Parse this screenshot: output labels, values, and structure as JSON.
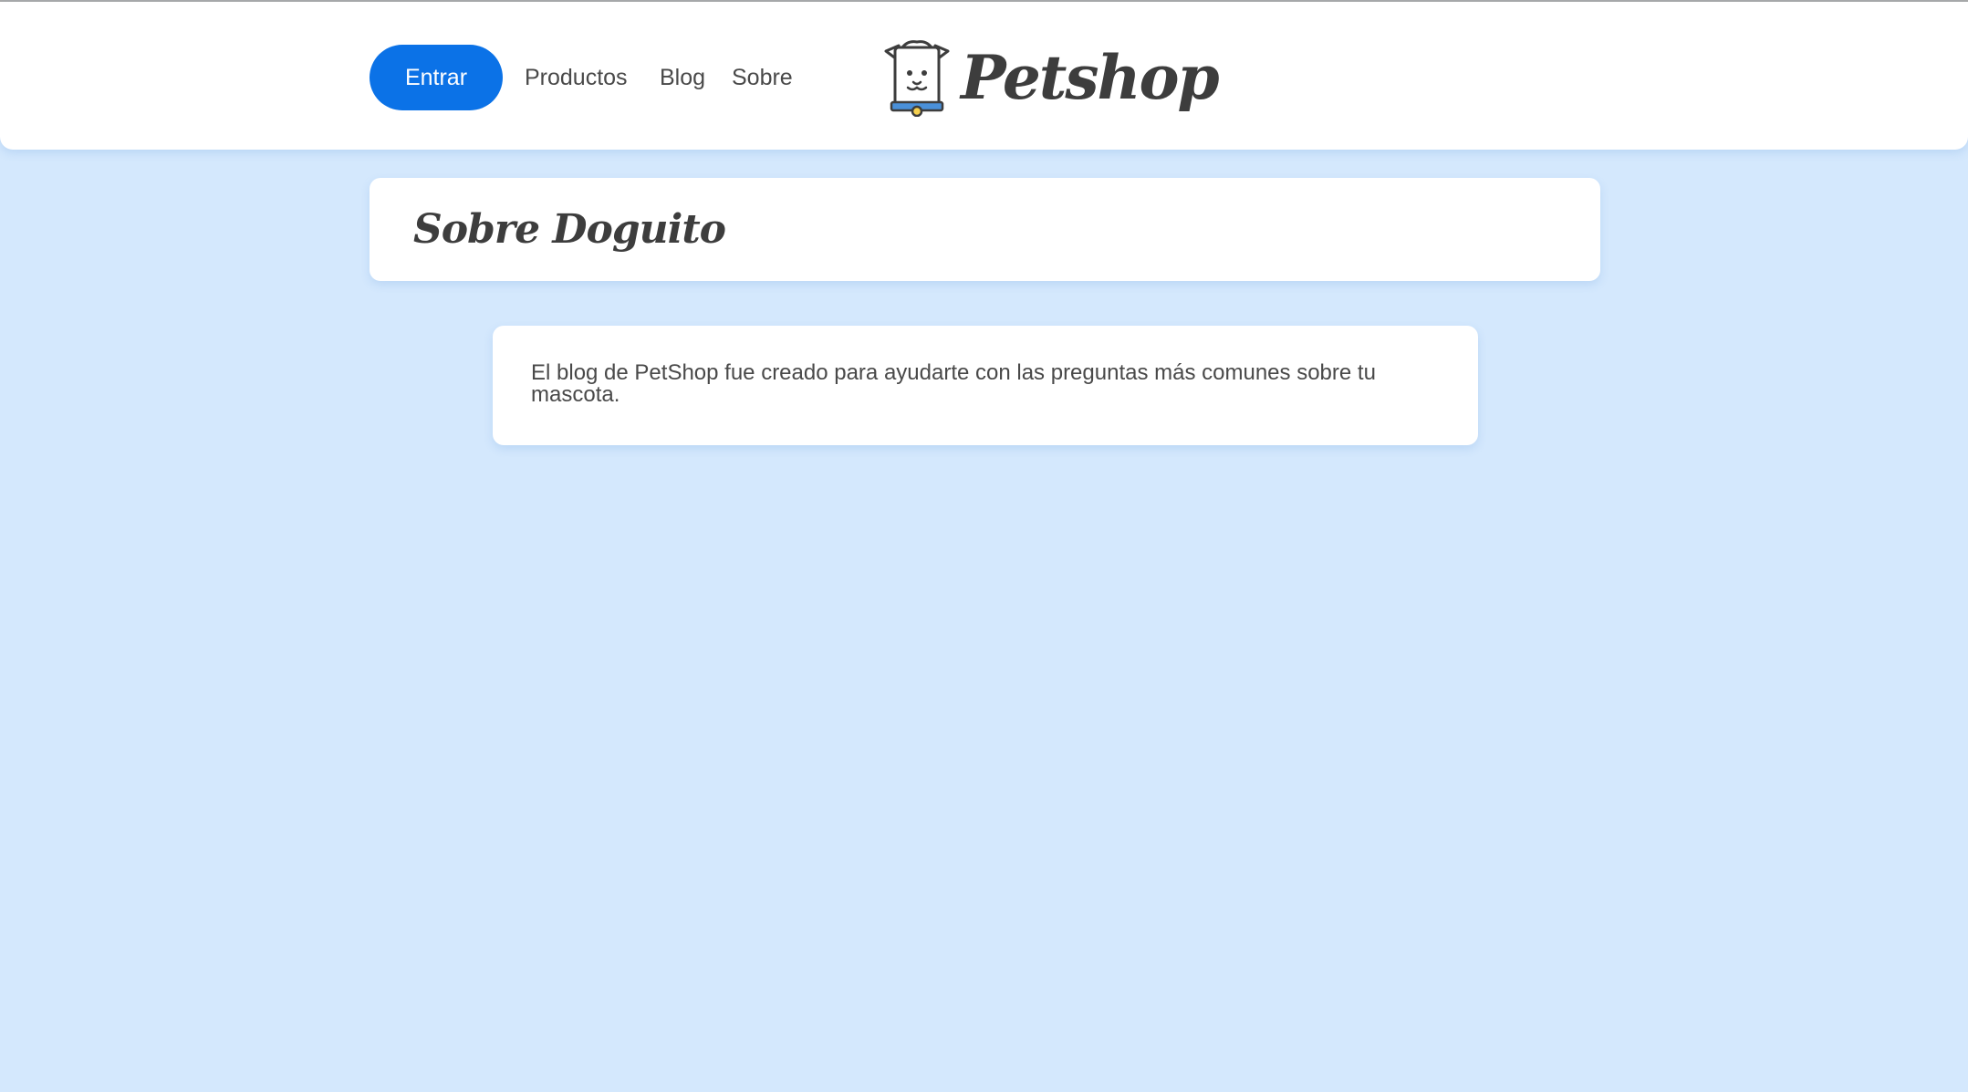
{
  "header": {
    "enter_label": "Entrar",
    "nav": {
      "products": "Productos",
      "blog": "Blog",
      "about": "Sobre"
    },
    "logo": {
      "text": "Petshop",
      "icon": "dog-icon"
    }
  },
  "main": {
    "title": "Sobre Doguito",
    "info_text": "El blog de PetShop fue creado para ayudarte con las preguntas más comunes sobre tu mascota."
  },
  "colors": {
    "background": "#d4e8fd",
    "accent": "#0b72e7",
    "text": "#494949",
    "title": "#3d3d3d",
    "collar": "#4a90d9",
    "tag": "#f5d04e"
  }
}
